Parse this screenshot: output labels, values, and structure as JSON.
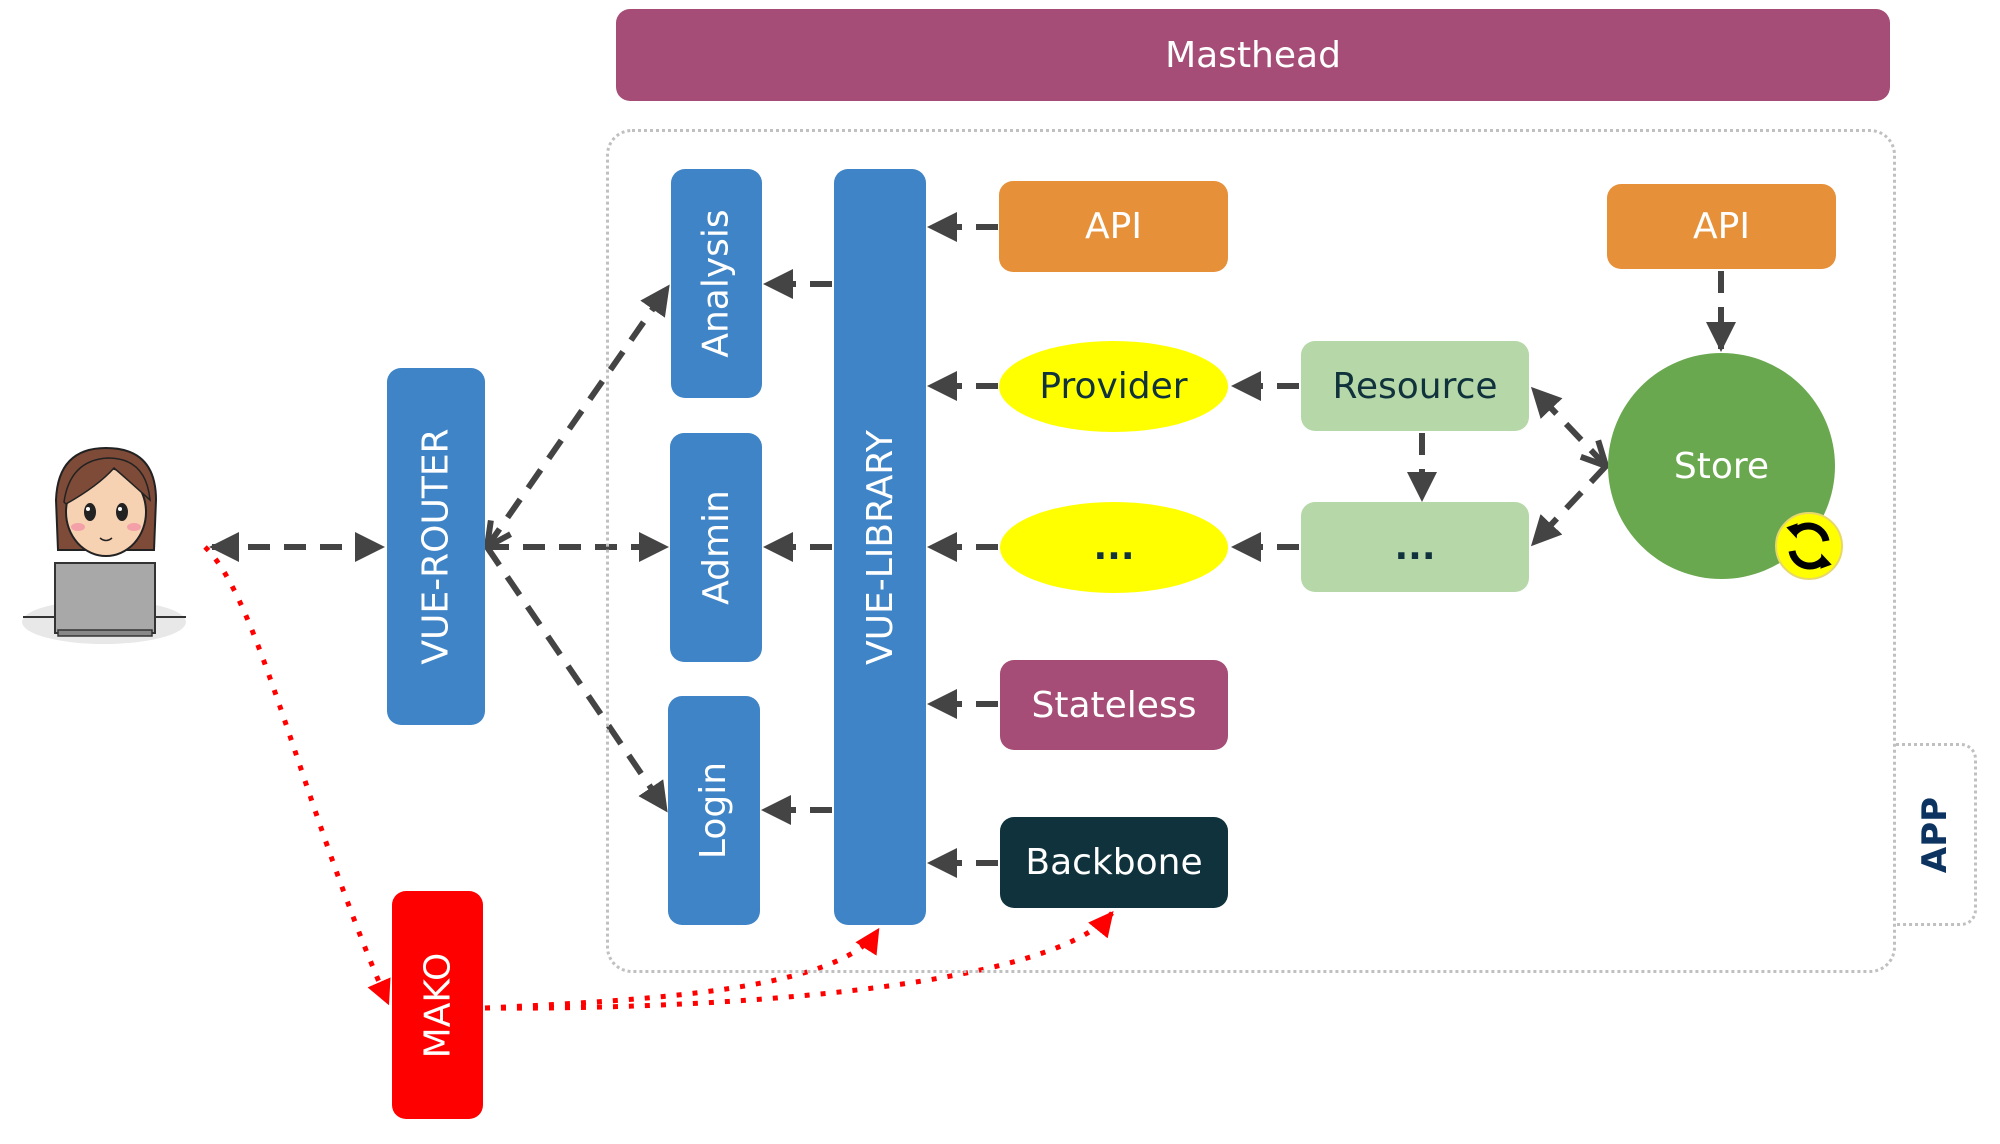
{
  "diagram": {
    "masthead": "Masthead",
    "app_label": "APP",
    "user": {
      "icon": "user-with-laptop-icon"
    },
    "router": "VUE-ROUTER",
    "mako": "MAKO",
    "pages": [
      "Analysis",
      "Admin",
      "Login"
    ],
    "library": "VUE-LIBRARY",
    "sources": {
      "api": "API",
      "provider": "Provider",
      "provider_more": "...",
      "stateless": "Stateless",
      "backbone": "Backbone"
    },
    "resource": "Resource",
    "resource_more": "...",
    "store": "Store",
    "store_api": "API",
    "store_icon": "refresh-icon",
    "colors": {
      "masthead": "#a54d76",
      "vue_blue": "#3f84c6",
      "api_orange": "#e69139",
      "provider_yellow": "#ffff00",
      "resource_green": "#b6d7a8",
      "store_green": "#6aa84f",
      "stateless_purple": "#a54d76",
      "backbone_dark": "#0f323c",
      "mako_red": "#ff0000",
      "arrow_gray": "#444444",
      "app_label_navy": "#0d3461"
    },
    "connections": [
      {
        "from": "user",
        "to": "router",
        "style": "dashed-bidirectional"
      },
      {
        "from": "router",
        "to": "Analysis",
        "style": "dashed"
      },
      {
        "from": "router",
        "to": "Admin",
        "style": "dashed"
      },
      {
        "from": "router",
        "to": "Login",
        "style": "dashed"
      },
      {
        "from": "library",
        "to": "Analysis",
        "style": "dashed"
      },
      {
        "from": "library",
        "to": "Admin",
        "style": "dashed"
      },
      {
        "from": "library",
        "to": "Login",
        "style": "dashed"
      },
      {
        "from": "API",
        "to": "library",
        "style": "dashed"
      },
      {
        "from": "Provider",
        "to": "library",
        "style": "dashed"
      },
      {
        "from": "...",
        "to": "library",
        "style": "dashed"
      },
      {
        "from": "Stateless",
        "to": "library",
        "style": "dashed"
      },
      {
        "from": "Backbone",
        "to": "library",
        "style": "dashed"
      },
      {
        "from": "Resource",
        "to": "Provider",
        "style": "dashed"
      },
      {
        "from": "Resource",
        "to": "...",
        "style": "dashed"
      },
      {
        "from": "...",
        "to": "...",
        "style": "dashed"
      },
      {
        "from": "Store",
        "to": "Resource",
        "style": "dashed"
      },
      {
        "from": "Store",
        "to": "...",
        "style": "dashed"
      },
      {
        "from": "API",
        "to": "Store",
        "style": "dashed"
      },
      {
        "from": "user",
        "to": "MAKO",
        "style": "red-dotted"
      },
      {
        "from": "MAKO",
        "to": "library",
        "style": "red-dotted"
      },
      {
        "from": "MAKO",
        "to": "Backbone",
        "style": "red-dotted"
      }
    ]
  }
}
